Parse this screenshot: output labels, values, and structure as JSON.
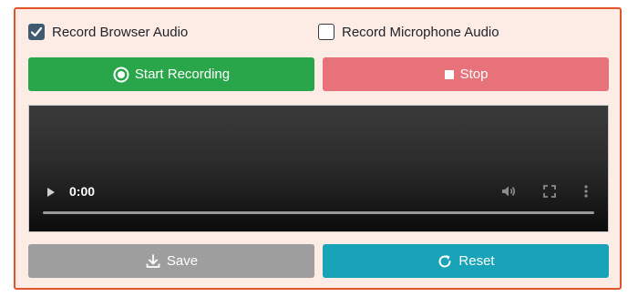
{
  "options": {
    "browser_audio": {
      "label": "Record Browser Audio",
      "checked": true
    },
    "microphone_audio": {
      "label": "Record Microphone Audio",
      "checked": false
    }
  },
  "buttons": {
    "start_label": "Start Recording",
    "stop_label": "Stop",
    "save_label": "Save",
    "reset_label": "Reset"
  },
  "player": {
    "current_time": "0:00"
  },
  "colors": {
    "panel_border": "#e2542a",
    "panel_background": "#fdebe6",
    "start": "#2aa64a",
    "stop": "#e8727a",
    "save": "#9e9e9e",
    "reset": "#18a3b8"
  },
  "icons": {
    "checkbox_checked": "check-icon",
    "start": "record-icon",
    "stop": "stop-square-icon",
    "save": "download-icon",
    "reset": "reset-icon",
    "player_play": "play-icon",
    "player_volume": "volume-icon",
    "player_fullscreen": "fullscreen-icon",
    "player_more": "more-vertical-icon"
  }
}
